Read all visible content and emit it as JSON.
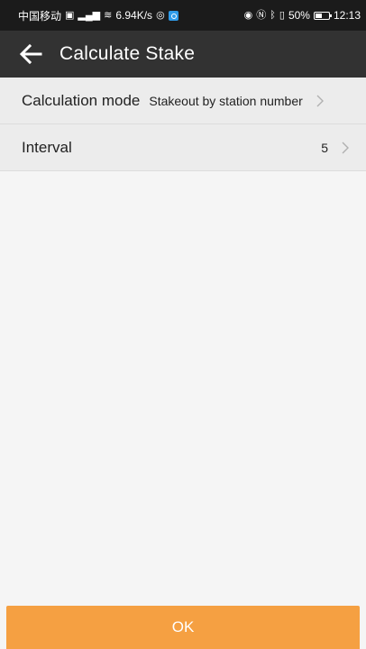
{
  "status_bar": {
    "carrier": "中国移动",
    "net_speed": "6.94K/s",
    "battery": "50%",
    "time": "12:13"
  },
  "app_bar": {
    "title": "Calculate Stake",
    "back_icon": "arrow-left-icon"
  },
  "settings": [
    {
      "label": "Calculation mode",
      "value": "Stakeout by station number"
    },
    {
      "label": "Interval",
      "value": "5"
    }
  ],
  "ok_button": {
    "label": "OK"
  },
  "colors": {
    "status_bar": "#1b1b1b",
    "app_bar": "#323232",
    "row_background": "#ececec",
    "accent": "#f5a042"
  }
}
